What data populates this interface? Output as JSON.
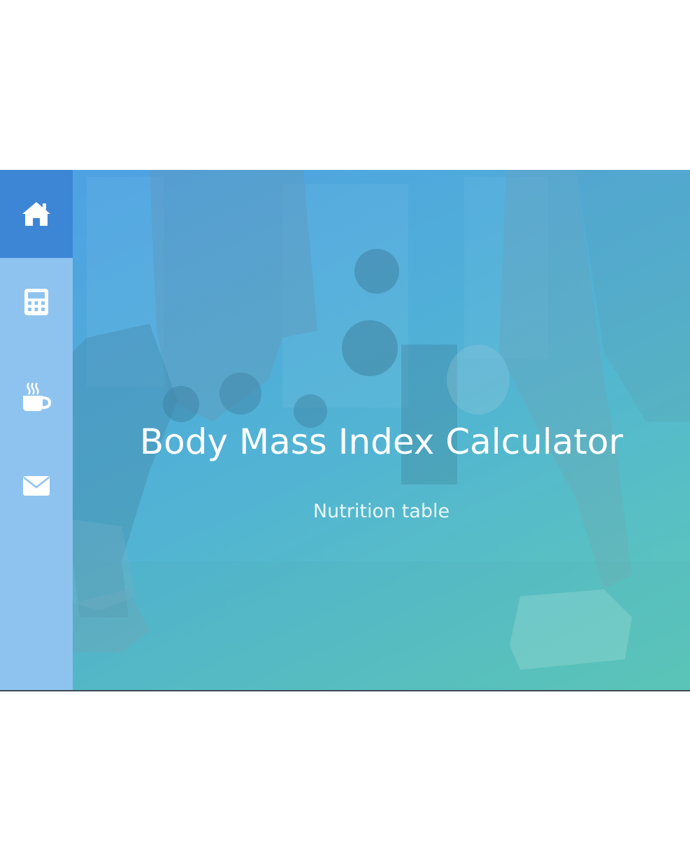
{
  "hero": {
    "title": "Body Mass Index Calculator",
    "subtitle": "Nutrition table"
  },
  "sidebar": {
    "items": [
      {
        "icon": "home-icon",
        "active": true
      },
      {
        "icon": "calculator-icon",
        "active": false
      },
      {
        "icon": "coffee-icon",
        "active": false
      },
      {
        "icon": "envelope-icon",
        "active": false
      }
    ]
  },
  "colors": {
    "sidebar_bg": "#8ec3ef",
    "sidebar_active": "#3d86d6",
    "gradient_start": "#4aa0e2",
    "gradient_end": "#5ccbb3",
    "text": "#ffffff"
  }
}
